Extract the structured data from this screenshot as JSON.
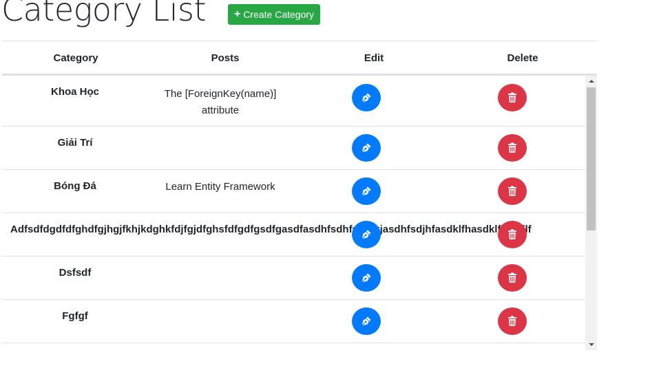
{
  "page": {
    "title": "Category List",
    "create_button_label": "Create Category"
  },
  "table": {
    "headers": {
      "category": "Category",
      "posts": "Posts",
      "edit": "Edit",
      "delete": "Delete"
    },
    "rows": [
      {
        "category": "Khoa Học",
        "posts": "The [ForeignKey(name)] attribute"
      },
      {
        "category": "Giải Trí",
        "posts": ""
      },
      {
        "category": "Bóng Đá",
        "posts": "Learn Entity Framework"
      },
      {
        "category": "Adfsdfdgdfdfghdfgjhgjfkhjkdghkfdjfgjdfghsfdfgdfgsdfgasdfasdhfsdhfsdhfkjasdhfsdjhfasdklfhasdklfhasdlf",
        "posts": ""
      },
      {
        "category": "Dsfsdf",
        "posts": ""
      },
      {
        "category": "Fgfgf",
        "posts": ""
      }
    ]
  },
  "icons": {
    "create": "plus-icon",
    "edit": "pen-nib-icon",
    "delete": "trash-icon"
  },
  "colors": {
    "create_button": "#28a745",
    "edit_button": "#007bff",
    "delete_button": "#dc3545"
  }
}
